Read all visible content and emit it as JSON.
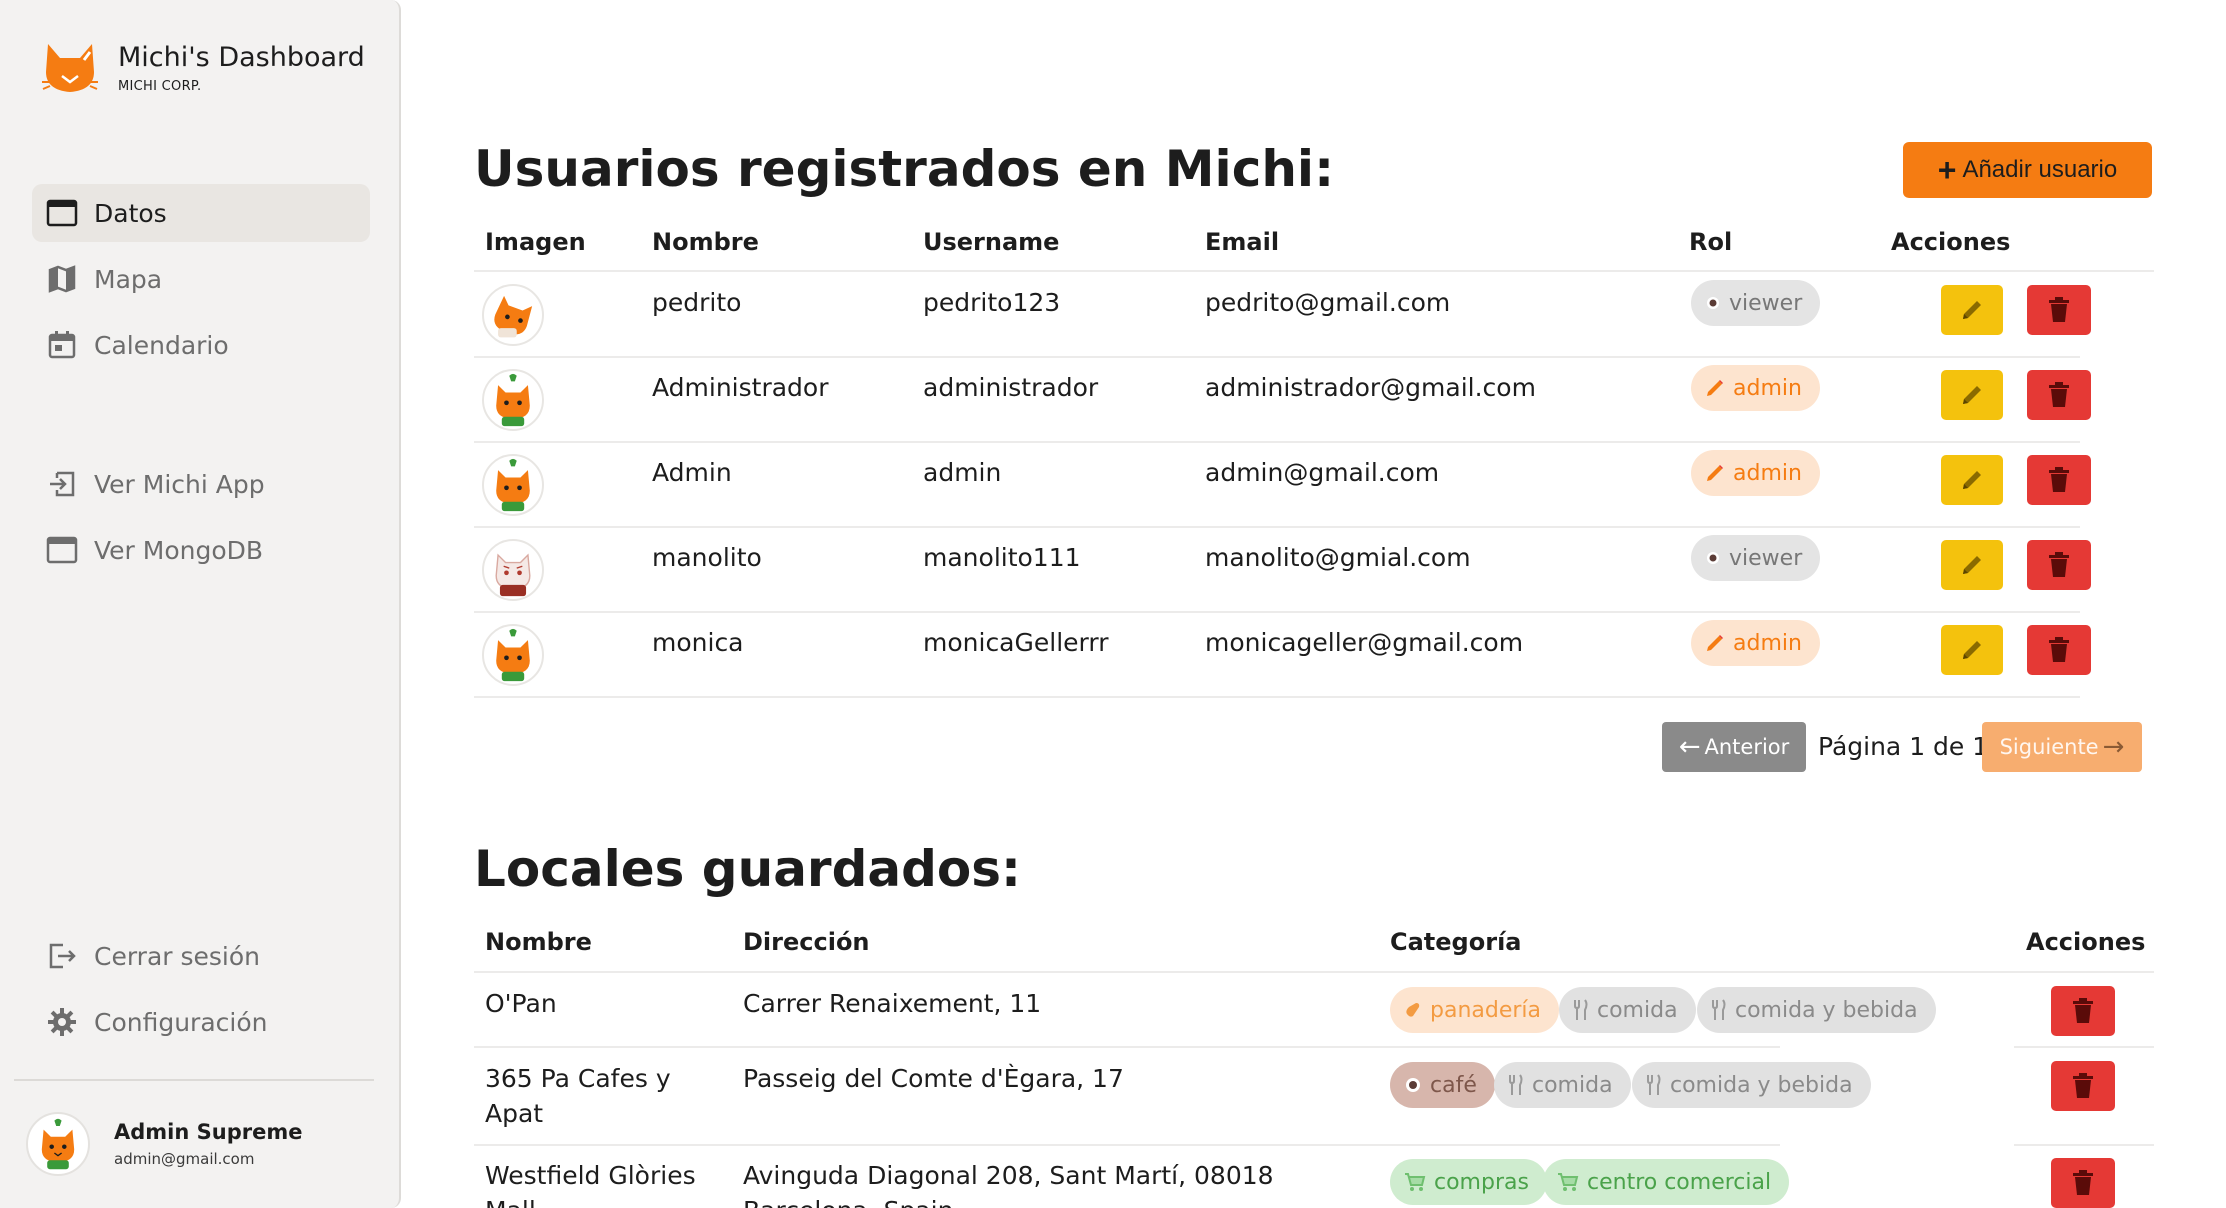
{
  "brand": {
    "title": "Michi's Dashboard",
    "subtitle": "MICHI CORP."
  },
  "sidebar": {
    "items": [
      {
        "label": "Datos",
        "icon": "window-icon",
        "active": true
      },
      {
        "label": "Mapa",
        "icon": "map-icon"
      },
      {
        "label": "Calendario",
        "icon": "calendar-icon"
      },
      {
        "label": "Ver Michi App",
        "icon": "login-arrow-icon"
      },
      {
        "label": "Ver MongoDB",
        "icon": "window-icon"
      },
      {
        "label": "Cerrar sesión",
        "icon": "logout-icon"
      },
      {
        "label": "Configuración",
        "icon": "gear-icon"
      }
    ],
    "user": {
      "name": "Admin Supreme",
      "email": "admin@gmail.com"
    }
  },
  "users_section": {
    "title": "Usuarios registrados en Michi:",
    "add_button": "Añadir usuario",
    "columns": [
      "Imagen",
      "Nombre",
      "Username",
      "Email",
      "Rol",
      "Acciones"
    ],
    "rows": [
      {
        "name": "pedrito",
        "username": "pedrito123",
        "email": "pedrito@gmail.com",
        "role": "viewer"
      },
      {
        "name": "Administrador",
        "username": "administrador",
        "email": "administrador@gmail.com",
        "role": "admin"
      },
      {
        "name": "Admin",
        "username": "admin",
        "email": "admin@gmail.com",
        "role": "admin"
      },
      {
        "name": "manolito",
        "username": "manolito111",
        "email": "manolito@gmial.com",
        "role": "viewer"
      },
      {
        "name": "monica",
        "username": "monicaGellerrr",
        "email": "monicageller@gmail.com",
        "role": "admin"
      }
    ],
    "pagination": {
      "prev": "Anterior",
      "page_text": "Página 1 de 1",
      "next": "Siguiente"
    }
  },
  "places_section": {
    "title": "Locales guardados:",
    "columns": [
      "Nombre",
      "Dirección",
      "Categoría",
      "Acciones"
    ],
    "rows": [
      {
        "name": "O'Pan",
        "name2": "",
        "address": "Carrer Renaixement, 11",
        "address2": "",
        "categories": [
          "panadería",
          "comida",
          "comida y bebida"
        ]
      },
      {
        "name": "365 Pa Cafes y",
        "name2": "Apat",
        "address": "Passeig del Comte d'Ègara, 17",
        "address2": "",
        "categories": [
          "café",
          "comida",
          "comida y bebida"
        ]
      },
      {
        "name": "Westfield Glòries",
        "name2": "Mall",
        "address": "Avinguda Diagonal 208, Sant Martí, 08018",
        "address2": "Barcelona, Spain",
        "categories": [
          "compras",
          "centro comercial"
        ]
      }
    ]
  },
  "colors": {
    "accent": "#f57c12",
    "edit": "#f4c20d",
    "delete": "#e53935",
    "prev": "#8a8a8a",
    "next": "#f7ad6f"
  }
}
